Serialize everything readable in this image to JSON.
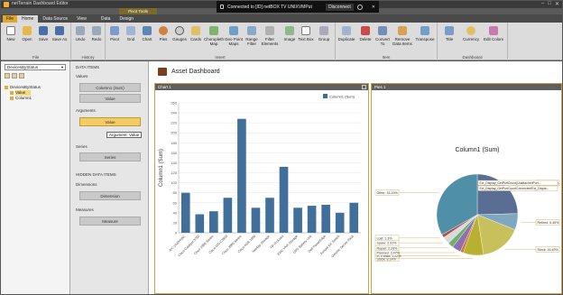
{
  "window": {
    "app_title": "netTerrain Dashboard Editor",
    "connection_text": "Connected to [ID] netBOX TV UNIXVMPut",
    "disconnect_label": "Disconnect",
    "context_tab_header": "Pivot Tools"
  },
  "tabs": [
    {
      "label": "File"
    },
    {
      "label": "Home"
    },
    {
      "label": "Data Source"
    },
    {
      "label": "View"
    },
    {
      "label": "Data"
    },
    {
      "label": "Design"
    }
  ],
  "ribbon": {
    "groups": [
      {
        "label": "File",
        "buttons": [
          "New",
          "Open",
          "Save",
          "Save As"
        ]
      },
      {
        "label": "History",
        "buttons": [
          "Undo",
          "Redo"
        ]
      },
      {
        "label": "Insert",
        "buttons": [
          "Pivot",
          "Grid",
          "Chart",
          "Pies",
          "Gauges",
          "Cards",
          "Choropleth Map",
          "Geo Point Maps",
          "Range Filter",
          "Filter Elements",
          "Image",
          "Text Box",
          "Group"
        ]
      },
      {
        "label": "Item",
        "buttons": [
          "Duplicate",
          "Delete",
          "Convert To",
          "Remove Data Items",
          "Transpose"
        ]
      },
      {
        "label": "Dashboard",
        "buttons": [
          "Title",
          "Currency",
          "Edit Colors"
        ]
      }
    ]
  },
  "left_panel": {
    "datasource_select": "DevicesByStatus",
    "tree": [
      {
        "label": "DevicesByStatus",
        "level": 0,
        "selected": false
      },
      {
        "label": "Value",
        "level": 1,
        "selected": true
      },
      {
        "label": "Column1",
        "level": 1,
        "selected": false
      }
    ]
  },
  "items_panel": {
    "title": "DATA ITEMS",
    "values_label": "Values",
    "values_slot": "Column1 (Sum)",
    "values_add": "Value",
    "arguments_label": "Arguments",
    "argument_slot": "Value",
    "argument_add": "Argument",
    "tooltip": "Argument: Value",
    "series_label": "Series",
    "series_slot": "Series",
    "hidden_title": "HIDDEN DATA ITEMS",
    "dimensions_label": "Dimensions",
    "dimension_slot": "Dimension",
    "measures_label": "Measures",
    "measure_slot": "Measure"
  },
  "dashboard": {
    "title": "Asset Dashboard",
    "chart_pane_title": "Chart 1",
    "pie_pane_title": "Pies 1"
  },
  "chart_data": [
    {
      "type": "bar",
      "ylabel": "Column1 (Sum)",
      "ylim": [
        0,
        260
      ],
      "yticks": [
        0,
        20,
        40,
        60,
        80,
        100,
        120,
        140,
        160,
        180,
        200,
        220,
        240,
        260
      ],
      "legend": "Column1 (Sum)",
      "legend_position": "top-right",
      "color": "#3f6f9a",
      "categories": [
        "A/C Unit/HVAC",
        "Cisco Catalyst 3750",
        "Cisco 2950 Series",
        "Cisco WS-C3560",
        "Cisco 3900 Series",
        "Cisco ASR 1000",
        "NetApp Storage",
        "HP ProLiant",
        "EMC VNX Storage",
        "UPS Battery Unit",
        "Dell PowerEdge",
        "Juniper EX Switch",
        "Generic Server Rack"
      ],
      "values": [
        80,
        37,
        43,
        70,
        228,
        50,
        70,
        132,
        50,
        54,
        56,
        40,
        60
      ]
    },
    {
      "type": "pie",
      "title": "Column1 (Sum)",
      "slices": [
        {
          "label": "Active: 24.57%",
          "value": 24.57,
          "color": "#5a6e93"
        },
        {
          "label": "Retired: 6.45%",
          "value": 6.45,
          "color": "#7fa7bf"
        },
        {
          "label": "Stock: 16.49%",
          "value": 16.49,
          "color": "#c8c05a"
        },
        {
          "label": "Stock: 8.14%",
          "value": 8.14,
          "color": "#b8b030"
        },
        {
          "label": "In Transit: 1.22%",
          "value": 1.22,
          "color": "#c97a3c"
        },
        {
          "label": "Planned: 3.47%",
          "value": 3.47,
          "color": "#8f6fb0"
        },
        {
          "label": "Repair: 2.26%",
          "value": 2.26,
          "color": "#6fb06f"
        },
        {
          "label": "Spare: 2.91%",
          "value": 2.91,
          "color": "#d9d9d9"
        },
        {
          "label": "Lost: 1.3%",
          "value": 1.3,
          "color": "#b04f4f"
        },
        {
          "label": "Other: 33.19%",
          "value": 33.19,
          "color": "#4f8fa8"
        }
      ],
      "legend_labels": [
        "Ext_Display_GetPortCount(UnattachedPort...",
        "Ext_Display_GetPortCountConnected/Ext_Displa..."
      ]
    }
  ]
}
